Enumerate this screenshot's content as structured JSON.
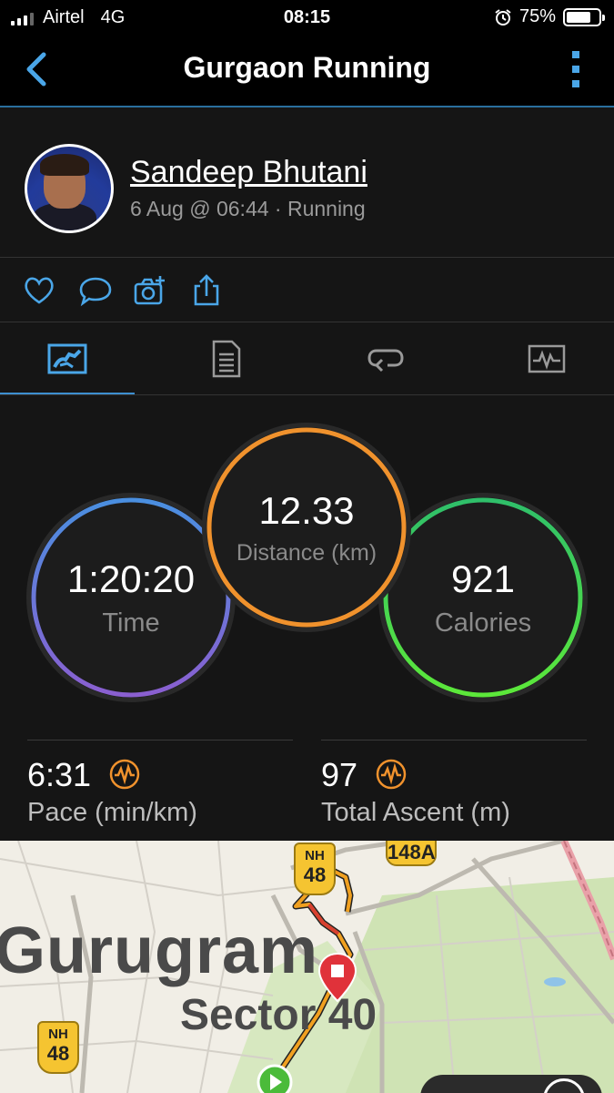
{
  "status_bar": {
    "carrier": "Airtel",
    "network": "4G",
    "time": "08:15",
    "battery": "75%",
    "battery_level": 0.75
  },
  "nav": {
    "title": "Gurgaon Running"
  },
  "activity": {
    "user_name": "Sandeep Bhutani",
    "meta": "6 Aug @ 06:44 · Running"
  },
  "circles": {
    "time": {
      "value": "1:20:20",
      "label": "Time"
    },
    "distance": {
      "value": "12.33",
      "label": "Distance (km)"
    },
    "calories": {
      "value": "921",
      "label": "Calories"
    }
  },
  "stats": {
    "pace": {
      "value": "6:31",
      "label": "Pace (min/km)"
    },
    "ascent": {
      "value": "97",
      "label": "Total Ascent (m)"
    }
  },
  "map": {
    "city": "Gurugram",
    "sector": "Sector 40",
    "shield_top": "NH",
    "shield_num": "48",
    "sign_148": "148A"
  },
  "colors": {
    "accent": "#4aa6e8",
    "time_ring": "#6a5fd0",
    "distance_ring": "#f0922d",
    "calories_ring": "#3fd65a"
  },
  "icons": [
    "back-icon",
    "more-icon",
    "like-icon",
    "comment-icon",
    "add-photo-icon",
    "share-icon",
    "overview-tab-icon",
    "details-tab-icon",
    "laps-tab-icon",
    "charts-tab-icon",
    "pace-badge-icon",
    "ascent-badge-icon",
    "map-end-pin-icon",
    "map-start-pin-icon"
  ]
}
